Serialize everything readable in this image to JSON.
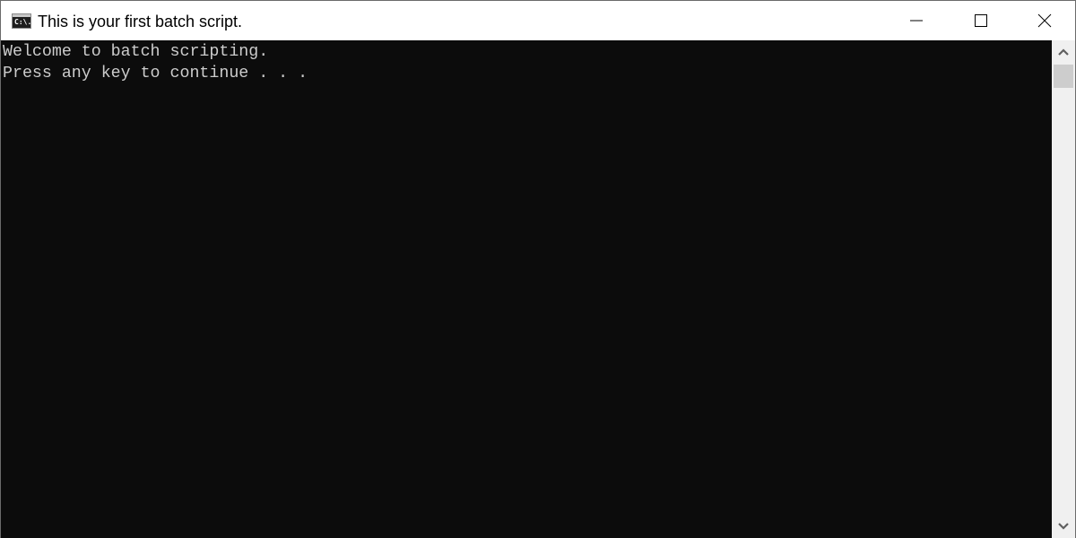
{
  "window": {
    "title": "This is your first batch script.",
    "icon": "cmd-icon",
    "icon_text": "C:\\.",
    "controls": [
      "minimize-icon",
      "maximize-icon",
      "close-icon"
    ]
  },
  "console": {
    "lines": [
      "Welcome to batch scripting.",
      "Press any key to continue . . ."
    ],
    "text_color": "#cccccc",
    "background_color": "#0c0c0c"
  },
  "scrollbar": {
    "up_icon": "chevron-up-icon",
    "down_icon": "chevron-down-icon"
  }
}
